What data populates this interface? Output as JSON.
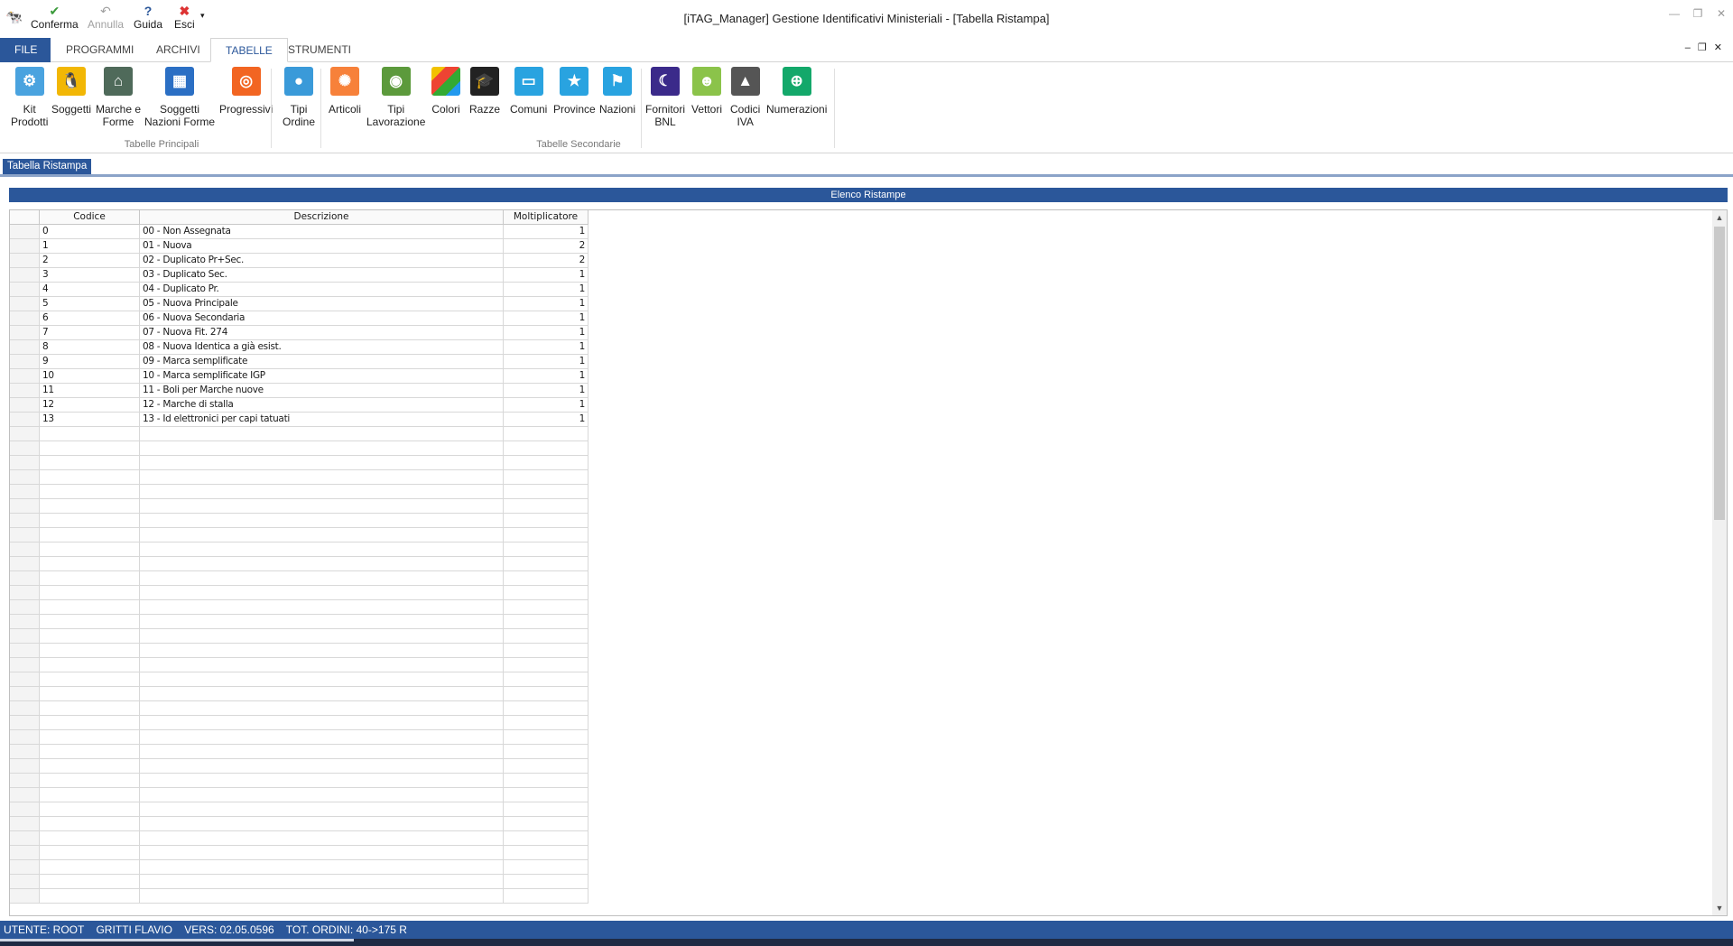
{
  "window": {
    "title": "[iTAG_Manager] Gestione Identificativi Ministeriali - [Tabella Ristampa]"
  },
  "quick_access": {
    "confirm": "Conferma",
    "undo": "Annulla",
    "help": "Guida",
    "exit": "Esci"
  },
  "tabs": [
    "FILE",
    "PROGRAMMI",
    "ARCHIVI",
    "TABELLE",
    "STRUMENTI"
  ],
  "ribbon": {
    "group_primary_label": "Tabelle Principali",
    "group_secondary_label": "Tabelle Secondarie",
    "buttons": [
      {
        "line1": "Kit",
        "line2": "Prodotti",
        "icon": "kit-icon"
      },
      {
        "line1": "Soggetti",
        "line2": "",
        "icon": "penguin-icon"
      },
      {
        "line1": "Marche e",
        "line2": "Forme",
        "icon": "tag-icon"
      },
      {
        "line1": "Soggetti",
        "line2": "Nazioni Forme",
        "icon": "grid-icon"
      },
      {
        "line1": "Progressivi",
        "line2": "",
        "icon": "ubuntu-icon"
      },
      {
        "line1": "Tipi",
        "line2": "Ordine",
        "icon": "bubble-icon"
      },
      {
        "line1": "Articoli",
        "line2": "",
        "icon": "atom-icon"
      },
      {
        "line1": "Tipi",
        "line2": "Lavorazione",
        "icon": "eye-icon"
      },
      {
        "line1": "Colori",
        "line2": "",
        "icon": "palette-icon"
      },
      {
        "line1": "Razze",
        "line2": "",
        "icon": "cap-icon"
      },
      {
        "line1": "Comuni",
        "line2": "",
        "icon": "folder-icon"
      },
      {
        "line1": "Province",
        "line2": "",
        "icon": "folder-star-icon"
      },
      {
        "line1": "Nazioni",
        "line2": "",
        "icon": "folder-flag-icon"
      },
      {
        "line1": "Fornitori",
        "line2": "BNL",
        "icon": "moon-icon"
      },
      {
        "line1": "Vettori",
        "line2": "",
        "icon": "android-icon"
      },
      {
        "line1": "Codici",
        "line2": "IVA",
        "icon": "triangle-icon"
      },
      {
        "line1": "Numerazioni",
        "line2": "",
        "icon": "globe-icon"
      }
    ]
  },
  "doc_tab": "Tabella Ristampa",
  "panel_title": "Elenco Ristampe",
  "grid": {
    "columns": [
      "Codice",
      "Descrizione",
      "Moltiplicatore"
    ],
    "rows": [
      [
        "0",
        "00 - Non Assegnata",
        "1"
      ],
      [
        "1",
        "01 - Nuova",
        "2"
      ],
      [
        "2",
        "02 - Duplicato Pr+Sec.",
        "2"
      ],
      [
        "3",
        "03 - Duplicato Sec.",
        "1"
      ],
      [
        "4",
        "04 - Duplicato Pr.",
        "1"
      ],
      [
        "5",
        "05 - Nuova Principale",
        "1"
      ],
      [
        "6",
        "06 - Nuova Secondaria",
        "1"
      ],
      [
        "7",
        "07 - Nuova Fit. 274",
        "1"
      ],
      [
        "8",
        "08 - Nuova Identica a già esist.",
        "1"
      ],
      [
        "9",
        "09 - Marca semplificate",
        "1"
      ],
      [
        "10",
        "10 - Marca semplificate IGP",
        "1"
      ],
      [
        "11",
        "11 - Boli per Marche nuove",
        "1"
      ],
      [
        "12",
        "12 - Marche di stalla",
        "1"
      ],
      [
        "13",
        "13 - Id elettronici per capi tatuati",
        "1"
      ]
    ]
  },
  "status": {
    "user": "UTENTE: ROOT",
    "name": "GRITTI FLAVIO",
    "version": "VERS: 02.05.0596",
    "orders": "TOT. ORDINI: 40->175 R"
  }
}
